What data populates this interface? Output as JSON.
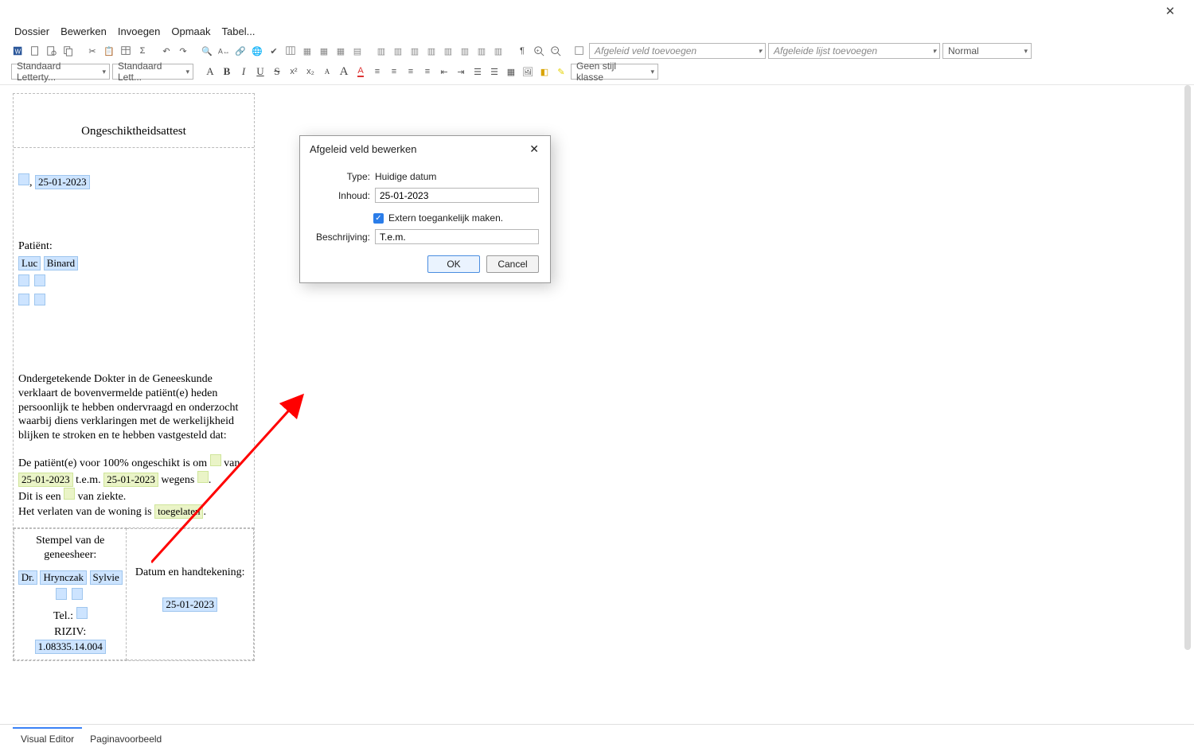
{
  "titlebar": {
    "close": "✕"
  },
  "menu": [
    "Dossier",
    "Bewerken",
    "Invoegen",
    "Opmaak",
    "Tabel..."
  ],
  "toolbar1": {
    "combo_afgeleid_veld": "Afgeleid veld toevoegen",
    "combo_afgeleide_lijst": "Afgeleide lijst toevoegen",
    "combo_normal": "Normal"
  },
  "toolbar2": {
    "font_combo": "Standaard Letterty...",
    "size_combo": "Standaard Lett...",
    "style_combo": "Geen stijl klasse"
  },
  "doc": {
    "title": "Ongeschiktheidsattest",
    "date1": "25-01-2023",
    "patient_label": "Patiënt:",
    "patient_first": "Luc",
    "patient_last": "Binard",
    "paragraph": "Ondergetekende Dokter in de Geneeskunde verklaart de bovenvermelde patiënt(e) heden persoonlijk te hebben ondervraagd en onderzocht waarbij diens verklaringen met de werkelijkheid blijken te stroken en te hebben vastgesteld dat:",
    "line2_a": "De patiënt(e) voor 100% ongeschikt is om",
    "line2_van": "van",
    "date_from": "25-01-2023",
    "tem": "t.e.m.",
    "date_to": "25-01-2023",
    "wegens": "wegens",
    "line3_a": "Dit is een",
    "line3_b": "van ziekte.",
    "line4_a": "Het verlaten van de woning is",
    "toegelaten": "toegelaten",
    "stempel_title": "Stempel van de geneesheer:",
    "dr": "Dr.",
    "doc_last": "Hrynczak",
    "doc_first": "Sylvie",
    "tel_label": "Tel.:",
    "riziv_label": "RIZIV:",
    "riziv_value": "1.08335.14.004",
    "sig_title": "Datum en handtekening:",
    "sig_date": "25-01-2023"
  },
  "dialog": {
    "title": "Afgeleid veld bewerken",
    "type_label": "Type:",
    "type_value": "Huidige datum",
    "inhoud_label": "Inhoud:",
    "inhoud_value": "25-01-2023",
    "checkbox_label": "Extern toegankelijk maken.",
    "beschr_label": "Beschrijving:",
    "beschr_value": "T.e.m.",
    "ok": "OK",
    "cancel": "Cancel"
  },
  "tabs": {
    "visual": "Visual Editor",
    "pagina": "Paginavoorbeeld"
  }
}
